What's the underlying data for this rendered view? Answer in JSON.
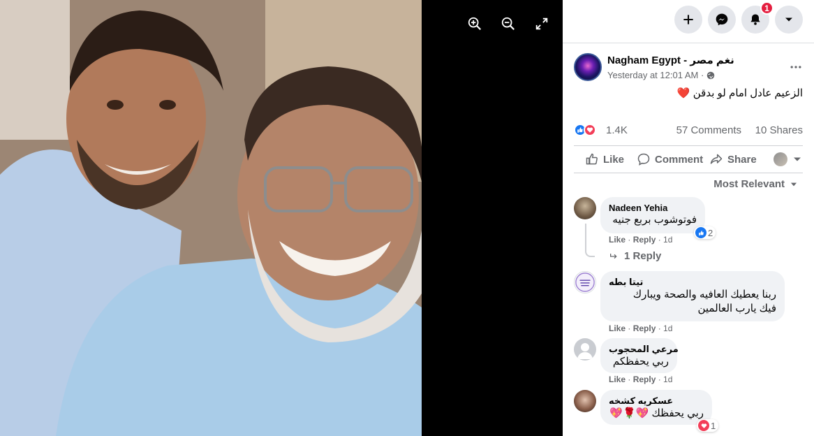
{
  "viewer": {
    "zoom_in": "zoom-in-icon",
    "zoom_out": "zoom-out-icon",
    "fullscreen": "fullscreen-icon"
  },
  "topbar": {
    "create": "plus-icon",
    "messenger": "messenger-icon",
    "notifications": "bell-icon",
    "notifications_count": "1",
    "account": "caret-down-icon"
  },
  "post": {
    "page_name": "Nagham Egypt - نغم مصر",
    "timestamp": "Yesterday at 12:01 AM ·",
    "text": "الزعيم عادل امام لو بدقن ❤️",
    "reactions_count": "1.4K",
    "comments_count": "57 Comments",
    "shares_count": "10 Shares"
  },
  "actions": {
    "like": "Like",
    "comment": "Comment",
    "share": "Share"
  },
  "sort": {
    "label": "Most Relevant"
  },
  "comments": [
    {
      "author": "Nadeen Yehia",
      "text": "فوتوشوب بربع جنيه",
      "like": "Like",
      "reply": "Reply",
      "time": "1d",
      "reactions": "2",
      "replies_link": "1 Reply"
    },
    {
      "author": "تيتا بطه",
      "text_line1": "ربنا يعطيك العافيه والصحة ويبارك",
      "text_line2": "فيك يارب العالمين",
      "like": "Like",
      "reply": "Reply",
      "time": "1d"
    },
    {
      "author": "مرعي المحجوب",
      "text": "ربي يحفظكم",
      "like": "Like",
      "reply": "Reply",
      "time": "1d"
    },
    {
      "author": "عسكريه كشخه",
      "text": "ربي يحفظك 💖🌹💖",
      "reactions": "1"
    }
  ],
  "colors": {
    "accent": "#1877f2",
    "love": "#f33e58",
    "notification_badge": "#e41e3f",
    "secondary_text": "#65676b",
    "bubble": "#f0f2f5"
  }
}
